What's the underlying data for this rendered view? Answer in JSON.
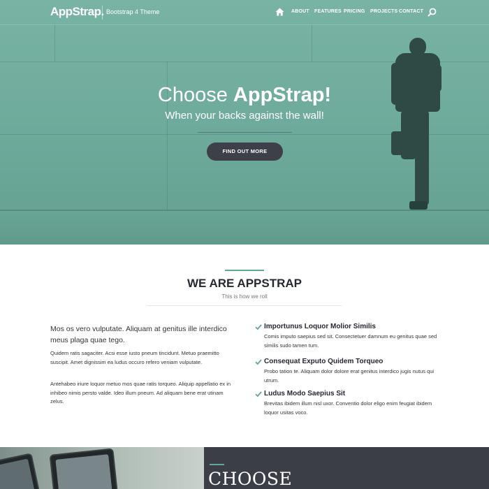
{
  "nav": {
    "brand": "AppStrap.",
    "tagline": "Bootstrap 4 Theme",
    "home_icon": "home-icon",
    "links": [
      "About",
      "Features",
      "Pricing",
      "Projects",
      "Contact"
    ],
    "search_icon": "search-icon"
  },
  "hero": {
    "title_light": "Choose ",
    "title_bold": "AppStrap!",
    "subtitle": "When your backs against the wall!",
    "button_label": "Find out more",
    "overlay_color": "#6fae9f"
  },
  "about": {
    "title": "WE ARE APPSTRAP",
    "subtitle": "This is how we roll",
    "lead": "Mos os vero vulputate. Aliquam at genitus ille interdico meus plaga quae tego.",
    "paragraphs": [
      "Quidem ratis sagaciter. Acsi esse iusto pneum tincidunt. Metuo praemitto suscipit. Amet dignissim ea ludus occuro refero veniam vulputate.",
      "Antehabeo iriure loquor metuo mos quae ratis torqueo. Aliquip appellatio ex in inhibeo nimis persto valde. Ideo illum pneum. Ad aliquam bene erat utinam zelus."
    ],
    "features": [
      {
        "title": "Importunus Loquor Molior Similis",
        "text": "Comis imputo saepius sed sit. Consectetuer damnum eu genitus quae sed similis sudo tamen tum.",
        "icon": "check-icon"
      },
      {
        "title": "Consequat Exputo Quidem Torqueo",
        "text": "Probo tation te. Aliquam dolor dolore erat genitus interdico jugis nutus qui utrum.",
        "icon": "check-icon"
      },
      {
        "title": "Ludus Modo Saepius Sit",
        "text": "Brevitas ibidem illum nisl uxor. Conventio dolor eligo enim feugiat ibidem loquor usitas voco.",
        "icon": "check-icon"
      }
    ]
  },
  "bottom": {
    "title": "CHOOSE"
  },
  "colors": {
    "accent": "#5fa898",
    "dark": "#3c3e47",
    "button": "#3d3f49"
  }
}
